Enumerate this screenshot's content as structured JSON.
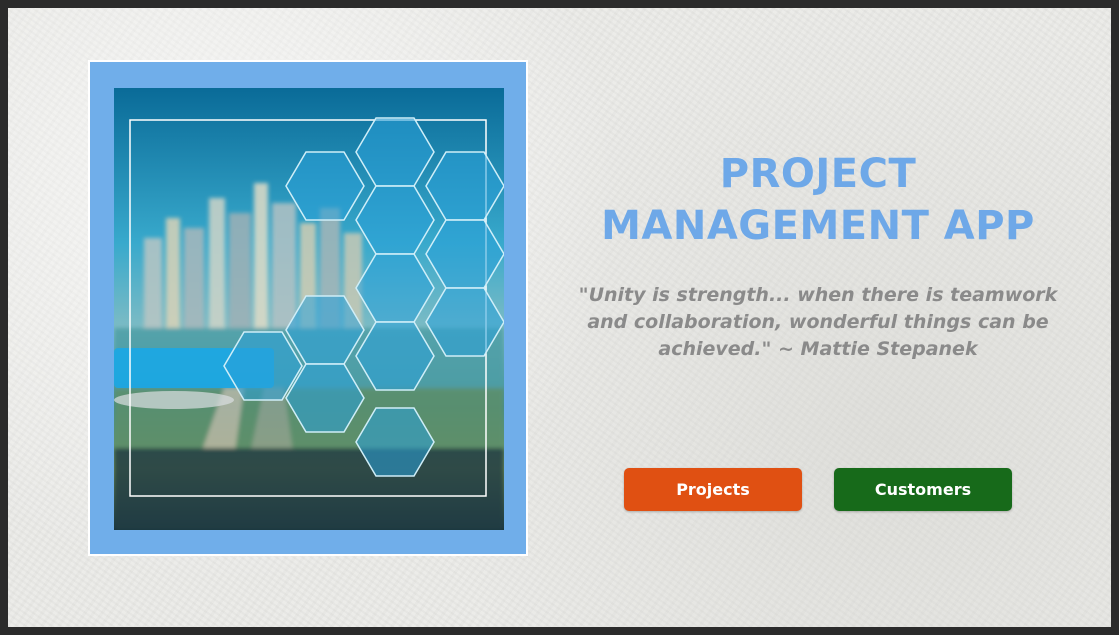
{
  "app": {
    "title_line1": "PROJECT",
    "title_line2": "MANAGEMENT APP",
    "quote": "\"Unity is strength... when there is teamwork and collaboration, wonderful things can be achieved.\" ~ Mattie Stepanek"
  },
  "buttons": {
    "projects_label": "Projects",
    "customers_label": "Customers"
  },
  "colors": {
    "title": "#6ea8e8",
    "photo_frame": "#70aeea",
    "projects_button": "#e05012",
    "customers_button": "#176a1a",
    "quote_text": "#8a8a8a"
  },
  "image": {
    "subject": "city-skyline-hexagon-network-photo"
  }
}
